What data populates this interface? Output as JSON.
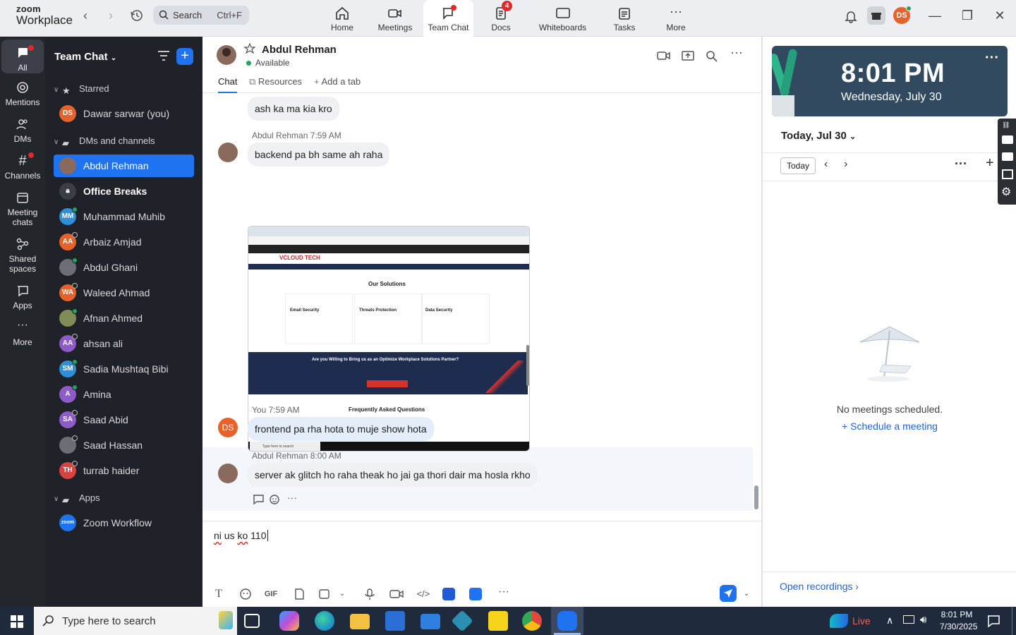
{
  "app": {
    "logo_line1": "zoom",
    "logo_line2": "Workplace",
    "search_label": "Search",
    "search_shortcut": "Ctrl+F"
  },
  "top_tabs": [
    {
      "label": "Home"
    },
    {
      "label": "Meetings"
    },
    {
      "label": "Team Chat"
    },
    {
      "label": "Docs",
      "badge": "4"
    },
    {
      "label": "Whiteboards"
    },
    {
      "label": "Tasks"
    },
    {
      "label": "More"
    }
  ],
  "profile_initials": "DS",
  "rail": [
    {
      "label": "All"
    },
    {
      "label": "Mentions"
    },
    {
      "label": "DMs"
    },
    {
      "label": "Channels"
    },
    {
      "label": "Meeting chats"
    },
    {
      "label": "Shared spaces"
    },
    {
      "label": "Apps"
    },
    {
      "label": "More"
    }
  ],
  "sidebar": {
    "title": "Team Chat",
    "sections": {
      "starred": "Starred",
      "dms": "DMs and channels",
      "apps": "Apps"
    },
    "starred_items": [
      {
        "name": "Dawar sarwar (you)",
        "initials": "DS",
        "color": "#e5622a"
      }
    ],
    "dm_items": [
      {
        "name": "Abdul Rehman",
        "initials": "",
        "color": "#8a6a5d",
        "selected": true
      },
      {
        "name": "Office Breaks",
        "initials": "",
        "color": "#555a62",
        "bold": true
      },
      {
        "name": "Muhammad Muhib",
        "initials": "MM",
        "color": "#2f8fd6"
      },
      {
        "name": "Arbaiz Amjad",
        "initials": "AA",
        "color": "#e5622a"
      },
      {
        "name": "Abdul Ghani",
        "initials": "",
        "color": "#6b6f75"
      },
      {
        "name": "Waleed Ahmad",
        "initials": "WA",
        "color": "#e5622a"
      },
      {
        "name": "Afnan Ahmed",
        "initials": "",
        "color": "#7e8c55"
      },
      {
        "name": "ahsan ali",
        "initials": "AA",
        "color": "#8e5bc9"
      },
      {
        "name": "Sadia Mushtaq Bibi",
        "initials": "SM",
        "color": "#2f8fd6"
      },
      {
        "name": "Amina",
        "initials": "A",
        "color": "#8e5bc9"
      },
      {
        "name": "Saad Abid",
        "initials": "SA",
        "color": "#8e5bc9"
      },
      {
        "name": "Saad Hassan",
        "initials": "",
        "color": "#6b6f75"
      },
      {
        "name": "turrab haider",
        "initials": "TH",
        "color": "#d8433f"
      }
    ],
    "app_items": [
      {
        "name": "Zoom Workflow",
        "initials": "zoom",
        "color": "#1f73f0"
      }
    ]
  },
  "chat": {
    "contact_name": "Abdul Rehman",
    "contact_status": "Available",
    "tabs": [
      "Chat",
      "Resources",
      "Add a tab"
    ],
    "messages": [
      {
        "text": "ash ka ma kia kro"
      },
      {
        "sender": "Abdul Rehman",
        "time": "7:59 AM",
        "text": "backend pa bh same ah raha"
      },
      {
        "sender": "You",
        "time": "7:59 AM",
        "text": "frontend pa rha hota to muje show hota",
        "initials": "DS"
      },
      {
        "sender": "Abdul Rehman",
        "time": "8:00 AM",
        "text": "server  ak glitch ho raha theak ho jai ga thori dair ma hosla rkho"
      }
    ],
    "screenshot": {
      "brand": "VCLOUD TECH",
      "heading": "Our Solutions",
      "cards": [
        "Email Security",
        "Threats Protection",
        "Data Security"
      ],
      "banner": "Are you Willing to Bring us as an Optimize Workplace Solutions Partner?",
      "faq": "Frequently Asked Questions",
      "taskbar_search": "Type here to search"
    },
    "composer": {
      "text_parts": [
        "ni",
        " us ",
        "ko",
        " 110"
      ]
    },
    "toolbar_gif": "GIF"
  },
  "right_panel": {
    "time": "8:01 PM",
    "date": "Wednesday, July 30",
    "cal_title": "Today, Jul 30",
    "today_button": "Today",
    "no_meetings": "No meetings scheduled.",
    "schedule_link": "Schedule a meeting",
    "open_recordings": "Open recordings"
  },
  "taskbar": {
    "search_placeholder": "Type here to search",
    "live": "Live",
    "time": "8:01 PM",
    "date": "7/30/2025"
  },
  "colors": {
    "accent": "#1f73f0",
    "sidebar_bg": "#1f2228",
    "rail_bg": "#23262b",
    "available": "#23a55a"
  }
}
